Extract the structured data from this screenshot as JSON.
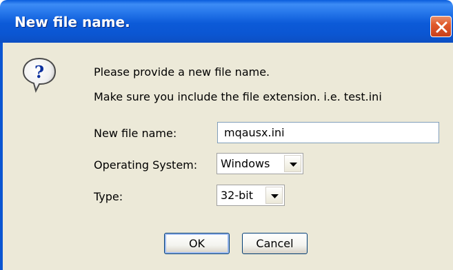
{
  "window": {
    "title": "New file name."
  },
  "message": {
    "line1": "Please provide a new file name.",
    "line2": "Make sure you include the file extension. i.e. test.ini"
  },
  "form": {
    "filename_label": "New file name:",
    "filename_value": "mqausx.ini",
    "os_label": "Operating System:",
    "os_value": "Windows",
    "type_label": "Type:",
    "type_value": "32-bit"
  },
  "buttons": {
    "ok_label": "OK",
    "cancel_label": "Cancel"
  },
  "icons": {
    "title_close": "close-icon",
    "message": "question-icon",
    "dropdown": "chevron-down-icon"
  },
  "colors": {
    "titlebar": "#0b56d2",
    "dialog_background": "#ece9d8",
    "close_button": "#e05a2c"
  }
}
